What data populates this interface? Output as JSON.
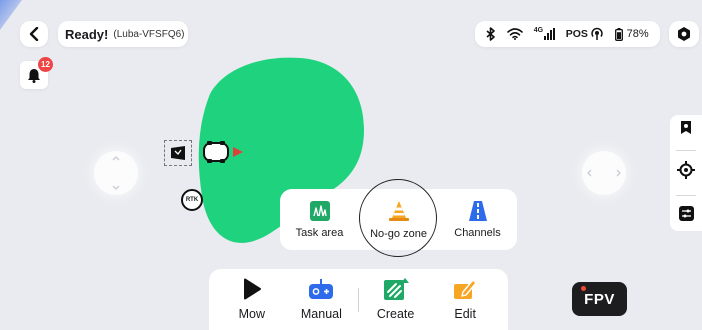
{
  "header": {
    "status": "Ready!",
    "device": "(Luba-VFSFQ6)",
    "network_label": "4G",
    "pos_label": "POS",
    "battery": "78%"
  },
  "notifications": {
    "count": "12"
  },
  "map": {
    "rtk_label": "RTK",
    "zone_color": "#1fd37e"
  },
  "create_menu": {
    "options": [
      {
        "label": "Task area",
        "icon": "grass-icon"
      },
      {
        "label": "No-go zone",
        "icon": "traffic-cone-icon"
      },
      {
        "label": "Channels",
        "icon": "road-icon"
      }
    ]
  },
  "bottom_bar": {
    "buttons": [
      {
        "label": "Mow",
        "icon": "play-icon"
      },
      {
        "label": "Manual",
        "icon": "gamepad-icon"
      },
      {
        "label": "Create",
        "icon": "create-icon"
      },
      {
        "label": "Edit",
        "icon": "pencil-icon"
      }
    ]
  },
  "fpv": {
    "label": "FPV"
  },
  "colors": {
    "accent_green": "#1fd37e",
    "accent_orange": "#f6a623",
    "accent_blue": "#2e6bea",
    "badge_red": "#f04444"
  }
}
